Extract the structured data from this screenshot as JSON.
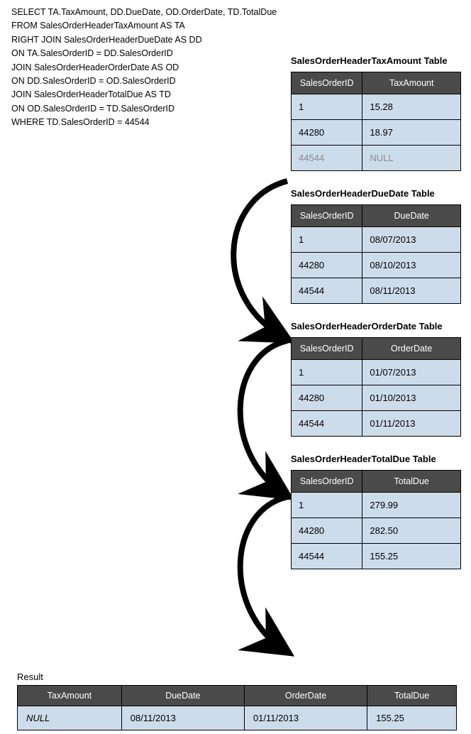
{
  "sql": {
    "l1": "SELECT TA.TaxAmount, DD.DueDate, OD.OrderDate, TD.TotalDue",
    "l2": "FROM SalesOrderHeaderTaxAmount AS TA",
    "l3": "RIGHT JOIN SalesOrderHeaderDueDate AS DD",
    "l4": "ON TA.SalesOrderID = DD.SalesOrderID",
    "l5": "JOIN SalesOrderHeaderOrderDate AS OD",
    "l6": "ON DD.SalesOrderID = OD.SalesOrderID",
    "l7": "JOIN SalesOrderHeaderTotalDue AS TD",
    "l8": "ON OD.SalesOrderID = TD.SalesOrderID",
    "l9": "WHERE TD.SalesOrderID = 44544"
  },
  "tables": [
    {
      "title": "SalesOrderHeaderTaxAmount Table",
      "h1": "SalesOrderID",
      "h2": "TaxAmount",
      "rows": [
        {
          "c1": "1",
          "c2": "15.28",
          "faded": false
        },
        {
          "c1": "44280",
          "c2": "18.97",
          "faded": false
        },
        {
          "c1": "44544",
          "c2": "NULL",
          "faded": true
        }
      ]
    },
    {
      "title": "SalesOrderHeaderDueDate Table",
      "h1": "SalesOrderID",
      "h2": "DueDate",
      "rows": [
        {
          "c1": "1",
          "c2": "08/07/2013",
          "faded": false
        },
        {
          "c1": "44280",
          "c2": "08/10/2013",
          "faded": false
        },
        {
          "c1": "44544",
          "c2": "08/11/2013",
          "faded": false
        }
      ]
    },
    {
      "title": "SalesOrderHeaderOrderDate Table",
      "h1": "SalesOrderID",
      "h2": "OrderDate",
      "rows": [
        {
          "c1": "1",
          "c2": "01/07/2013",
          "faded": false
        },
        {
          "c1": "44280",
          "c2": "01/10/2013",
          "faded": false
        },
        {
          "c1": "44544",
          "c2": "01/11/2013",
          "faded": false
        }
      ]
    },
    {
      "title": "SalesOrderHeaderTotalDue Table",
      "h1": "SalesOrderID",
      "h2": "TotalDue",
      "rows": [
        {
          "c1": "1",
          "c2": "279.99",
          "faded": false
        },
        {
          "c1": "44280",
          "c2": "282.50",
          "faded": false
        },
        {
          "c1": "44544",
          "c2": "155.25",
          "faded": false
        }
      ]
    }
  ],
  "result": {
    "title": "Result",
    "headers": [
      "TaxAmount",
      "DueDate",
      "OrderDate",
      "TotalDue"
    ],
    "row": {
      "c1": "NULL",
      "c2": "08/11/2013",
      "c3": "01/11/2013",
      "c4": "155.25"
    }
  }
}
